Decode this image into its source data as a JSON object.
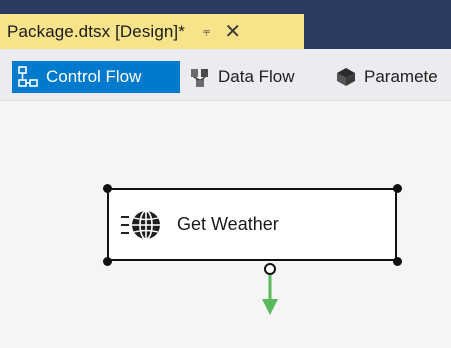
{
  "document_tab": {
    "title": "Package.dtsx [Design]*",
    "pin_icon": "pin-icon",
    "close_icon": "close-icon"
  },
  "designer_tabs": [
    {
      "label": "Control Flow",
      "icon": "control-flow-icon",
      "active": true
    },
    {
      "label": "Data Flow",
      "icon": "data-flow-icon",
      "active": false
    },
    {
      "label": "Paramete",
      "icon": "parameters-icon",
      "active": false
    }
  ],
  "canvas": {
    "task": {
      "label": "Get Weather",
      "icon": "web-service-globe-icon"
    }
  },
  "colors": {
    "title_bar": "#2d3b63",
    "document_tab": "#f7e38a",
    "active_tab": "#007acc",
    "precedence_arrow": "#5cb85c"
  }
}
